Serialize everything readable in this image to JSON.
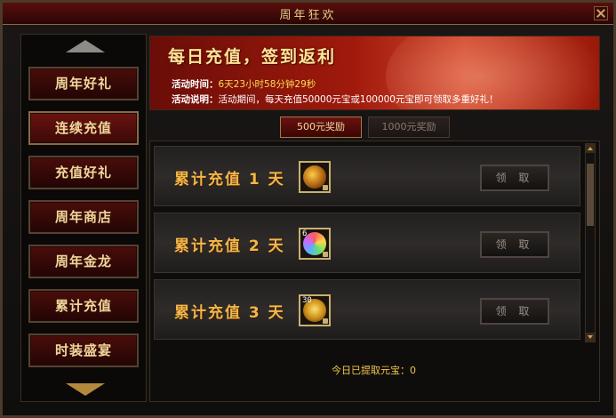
{
  "window": {
    "title": "周年狂欢"
  },
  "sidebar": {
    "items": [
      {
        "label": "周年好礼"
      },
      {
        "label": "连续充值"
      },
      {
        "label": "充值好礼"
      },
      {
        "label": "周年商店"
      },
      {
        "label": "周年金龙"
      },
      {
        "label": "累计充值"
      },
      {
        "label": "时装盛宴"
      }
    ],
    "scroll_up_icon": "chevron-up-icon",
    "scroll_down_icon": "chevron-down-icon"
  },
  "banner": {
    "headline": "每日充值，签到返利",
    "time_label": "活动时间：",
    "time_value": "6天23小时58分钟29秒",
    "desc_label": "活动说明：",
    "desc_value": "活动期间，每天充值50000元宝或100000元宝即可领取多重好礼！"
  },
  "tabs": [
    {
      "label": "500元奖励"
    },
    {
      "label": "1000元奖励"
    }
  ],
  "rewards": [
    {
      "label": "累计充值 1 天",
      "item_count": "",
      "claim_label": "领 取"
    },
    {
      "label": "累计充值 2 天",
      "item_count": "6",
      "claim_label": "领 取"
    },
    {
      "label": "累计充值 3 天",
      "item_count": "30",
      "claim_label": "领 取"
    }
  ],
  "footer": {
    "text": "今日已提取元宝：0"
  },
  "colors": {
    "accent_gold": "#f3b64a",
    "title_red": "#5a0e0b"
  }
}
